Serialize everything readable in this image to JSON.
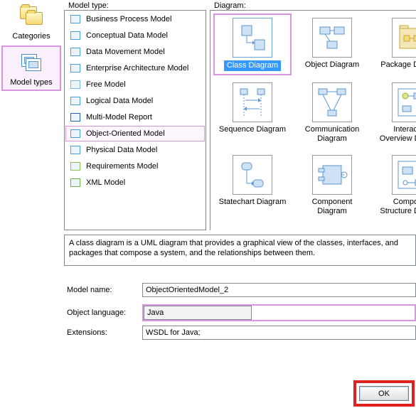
{
  "left_panel": {
    "categories_label": "Categories",
    "model_types_label": "Model types"
  },
  "labels": {
    "model_type": "Model type:",
    "diagram": "Diagram:",
    "model_name": "Model name:",
    "object_language": "Object language:",
    "extensions": "Extensions:"
  },
  "model_types": [
    {
      "label": "Business Process Model",
      "icon_color": "#4aa0d9"
    },
    {
      "label": "Conceptual Data Model",
      "icon_color": "#4aa0d9"
    },
    {
      "label": "Data Movement Model",
      "icon_color": "#4aa0d9"
    },
    {
      "label": "Enterprise Architecture Model",
      "icon_color": "#4aa0d9"
    },
    {
      "label": "Free Model",
      "icon_color": "#7ab6e0"
    },
    {
      "label": "Logical Data Model",
      "icon_color": "#4aa0d9"
    },
    {
      "label": "Multi-Model Report",
      "icon_color": "#2b62b5"
    },
    {
      "label": "Object-Oriented Model",
      "icon_color": "#4aa0d9",
      "selected": true
    },
    {
      "label": "Physical Data Model",
      "icon_color": "#4aa0d9"
    },
    {
      "label": "Requirements Model",
      "icon_color": "#8bc34a"
    },
    {
      "label": "XML Model",
      "icon_color": "#6fae3f"
    }
  ],
  "diagrams": [
    {
      "label": "Class Diagram",
      "selected": true
    },
    {
      "label": "Object Diagram"
    },
    {
      "label": "Package Diagram"
    },
    {
      "label": "Sequence Diagram"
    },
    {
      "label": "Communication Diagram"
    },
    {
      "label": "Interaction Overview Diagram"
    },
    {
      "label": "Statechart Diagram"
    },
    {
      "label": "Component Diagram"
    },
    {
      "label": "Composite Structure Diagram"
    }
  ],
  "description": "A class diagram is a UML diagram that provides a graphical view of the classes, interfaces, and packages that compose a system, and the relationships between them.",
  "form": {
    "model_name_value": "ObjectOrientedModel_2",
    "object_language_value": "Java",
    "extensions_value": "WSDL for Java;"
  },
  "buttons": {
    "ok": "OK"
  }
}
